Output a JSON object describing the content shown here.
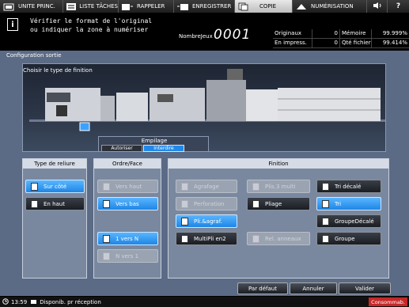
{
  "tabs": [
    {
      "label": "UNITE PRINC.",
      "icon": "home-icon"
    },
    {
      "label": "LISTE TÂCHES",
      "icon": "job-list-icon"
    },
    {
      "label": "RAPPELER",
      "icon": "recall-icon"
    },
    {
      "label": "ENREGISTRER",
      "icon": "store-icon"
    },
    {
      "label": "COPIE",
      "icon": "copy-icon"
    },
    {
      "label": "NUMÉRISATION",
      "icon": "scan-icon"
    }
  ],
  "message": {
    "line1": "Vérifier le format de l'original",
    "line2": "ou indiquer la zone à numériser"
  },
  "counter": {
    "label": "NombreJeux",
    "value": "0001"
  },
  "counts": [
    {
      "label": "Originaux",
      "value": "0",
      "label2": "Mémoire",
      "value2": "99.999%"
    },
    {
      "label": "En impress.",
      "value": "0",
      "label2": "Qté fichier",
      "value2": "99.414%"
    }
  ],
  "screen_title": "Configuration sortie",
  "machine": {
    "prompt": "Choisir le type de finition"
  },
  "empilage": {
    "title": "Empilage",
    "options": [
      "Autoriser",
      "Interdire"
    ],
    "selected": "Interdire"
  },
  "reliure": {
    "title": "Type de reliure",
    "options": [
      {
        "label": "Sur côté",
        "state": "on"
      },
      {
        "label": "En haut",
        "state": "off"
      }
    ]
  },
  "ordre": {
    "title": "Ordre/Face",
    "options": [
      {
        "label": "Vers haut",
        "state": "dis"
      },
      {
        "label": "Vers bas",
        "state": "on"
      },
      {
        "label": "1 vers N",
        "state": "on"
      },
      {
        "label": "N vers 1",
        "state": "dis"
      }
    ]
  },
  "finition": {
    "title": "Finition",
    "buttons": [
      {
        "label": "Agrafage",
        "state": "dis"
      },
      {
        "label": "Plis.3 multi",
        "state": "dis"
      },
      {
        "label": "Tri décalé",
        "state": "off"
      },
      {
        "label": "Perforation",
        "state": "dis"
      },
      {
        "label": "Pliage",
        "state": "off"
      },
      {
        "label": "Tri",
        "state": "on"
      },
      {
        "label": "Pli.&agraf.",
        "state": "on"
      },
      {
        "label": "GroupeDécalé",
        "state": "off"
      },
      {
        "label": "MultiPli en2",
        "state": "off"
      },
      {
        "label": "Rel. anneaux",
        "state": "dis"
      },
      {
        "label": "Groupe",
        "state": "off"
      }
    ]
  },
  "actions": {
    "default": "Par défaut",
    "cancel": "Annuler",
    "ok": "Valider"
  },
  "status": {
    "time": "13:59",
    "text": "Disponib. pr réception",
    "right": "Consommab."
  }
}
